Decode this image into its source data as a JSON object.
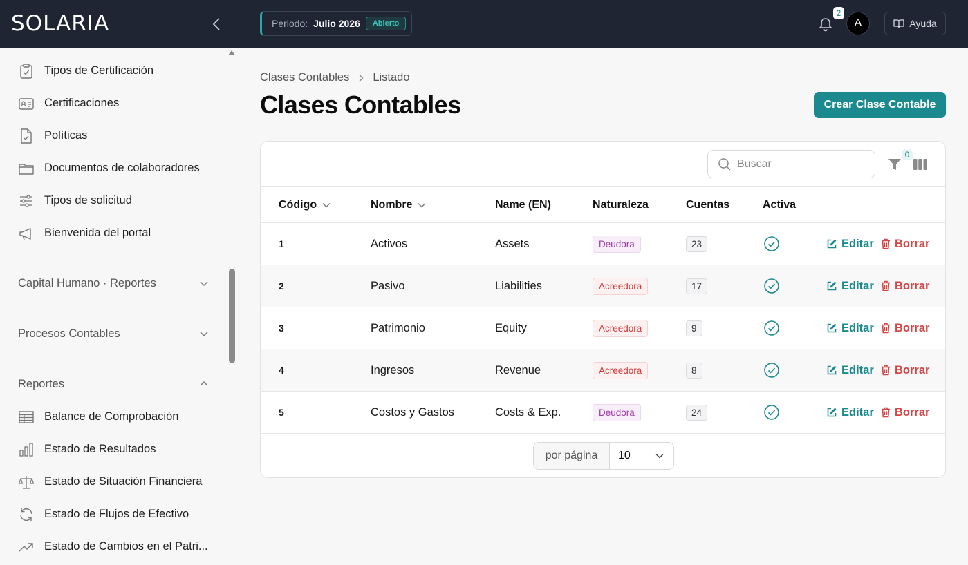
{
  "brand": {
    "logo_text": "SOLARIA"
  },
  "header": {
    "period_label": "Periodo:",
    "period_value": "Julio 2026",
    "period_status": "Abierto",
    "notifications_count": "2",
    "avatar_initial": "A",
    "help_label": "Ayuda"
  },
  "sidebar": {
    "items_top": [
      {
        "label": "Tipos de Certificación",
        "icon": "clipboard-check-icon"
      },
      {
        "label": "Certificaciones",
        "icon": "id-card-icon"
      },
      {
        "label": "Políticas",
        "icon": "file-check-icon"
      },
      {
        "label": "Documentos de colaboradores",
        "icon": "folder-icon"
      },
      {
        "label": "Tipos de solicitud",
        "icon": "sliders-icon"
      },
      {
        "label": "Bienvenida del portal",
        "icon": "megaphone-icon"
      }
    ],
    "groups": [
      {
        "label": "Capital Humano · Reportes",
        "expanded": false
      },
      {
        "label": "Procesos Contables",
        "expanded": false
      },
      {
        "label": "Reportes",
        "expanded": true
      }
    ],
    "report_items": [
      {
        "label": "Balance de Comprobación",
        "icon": "table-icon"
      },
      {
        "label": "Estado de Resultados",
        "icon": "bar-chart-icon"
      },
      {
        "label": "Estado de Situación Financiera",
        "icon": "scale-icon"
      },
      {
        "label": "Estado de Flujos de Efectivo",
        "icon": "refresh-icon"
      },
      {
        "label": "Estado de Cambios en el Patri...",
        "icon": "trending-up-icon"
      }
    ]
  },
  "breadcrumb": {
    "parent": "Clases Contables",
    "current": "Listado"
  },
  "page": {
    "title": "Clases Contables",
    "create_label": "Crear Clase Contable"
  },
  "toolbar": {
    "search_placeholder": "Buscar",
    "filter_count": "0"
  },
  "table": {
    "columns": [
      "Código",
      "Nombre",
      "Name (EN)",
      "Naturaleza",
      "Cuentas",
      "Activa"
    ],
    "rows": [
      {
        "code": "1",
        "name": "Activos",
        "name_en": "Assets",
        "nature": "Deudora",
        "accounts": "23",
        "active": true
      },
      {
        "code": "2",
        "name": "Pasivo",
        "name_en": "Liabilities",
        "nature": "Acreedora",
        "accounts": "17",
        "active": true
      },
      {
        "code": "3",
        "name": "Patrimonio",
        "name_en": "Equity",
        "nature": "Acreedora",
        "accounts": "9",
        "active": true
      },
      {
        "code": "4",
        "name": "Ingresos",
        "name_en": "Revenue",
        "nature": "Acreedora",
        "accounts": "8",
        "active": true
      },
      {
        "code": "5",
        "name": "Costos y Gastos",
        "name_en": "Costs & Exp.",
        "nature": "Deudora",
        "accounts": "24",
        "active": true
      }
    ],
    "edit_label": "Editar",
    "delete_label": "Borrar"
  },
  "pagination": {
    "per_page_label": "por página",
    "per_page_value": "10"
  },
  "colors": {
    "accent": "#1b8a8f",
    "topbar": "#1f2533",
    "danger": "#d64545",
    "debit": "#9b3aa3",
    "credit": "#d53b3b"
  }
}
